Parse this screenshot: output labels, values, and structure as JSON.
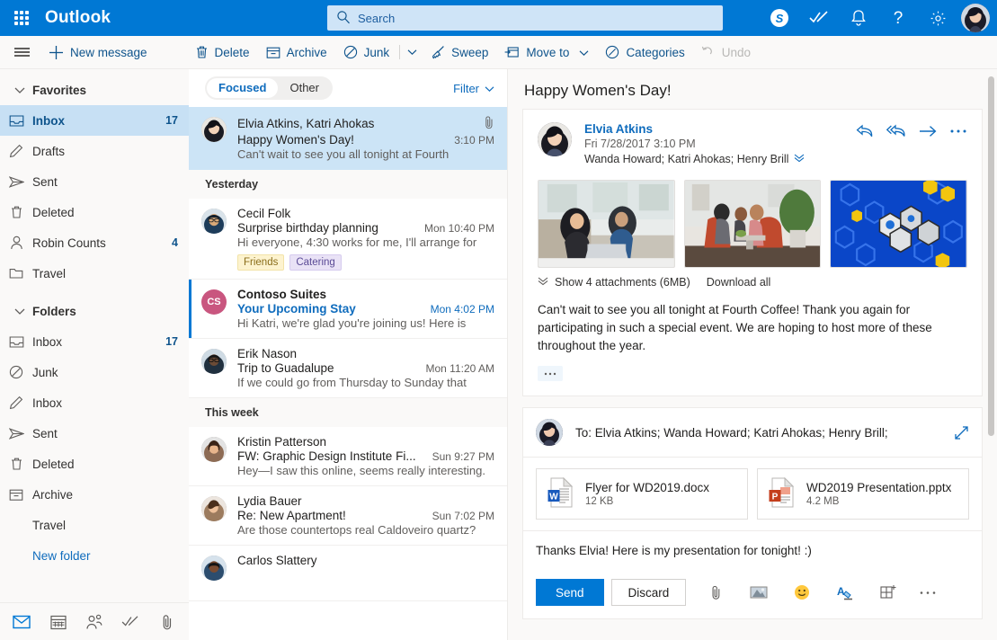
{
  "header": {
    "brand": "Outlook",
    "waffle_icon": "app-launcher-icon",
    "search": {
      "placeholder": "Search",
      "value": "",
      "icon": "search-icon"
    },
    "actions": [
      {
        "name": "skype-icon",
        "label": "S"
      },
      {
        "name": "to-do-icon",
        "label": ""
      },
      {
        "name": "notifications-bell-icon",
        "label": ""
      },
      {
        "name": "help-icon",
        "label": "?"
      },
      {
        "name": "settings-gear-icon",
        "label": ""
      }
    ],
    "avatar": "user-avatar"
  },
  "toolbar": {
    "menu_label": "",
    "new_message": "New message",
    "items": [
      {
        "label": "Delete",
        "icon": "trash-icon",
        "disabled": false
      },
      {
        "label": "Archive",
        "icon": "archive-icon",
        "disabled": false
      },
      {
        "label": "Junk",
        "icon": "block-icon",
        "disabled": false
      },
      {
        "label": "Sweep",
        "icon": "broom-icon",
        "disabled": false
      },
      {
        "label": "Move to",
        "icon": "move-to-icon",
        "disabled": false
      },
      {
        "label": "Categories",
        "icon": "category-tag-icon",
        "disabled": false
      },
      {
        "label": "Undo",
        "icon": "undo-icon",
        "disabled": true
      }
    ]
  },
  "sidebar": {
    "favorites": {
      "title": "Favorites",
      "items": [
        {
          "label": "Inbox",
          "count": "17",
          "icon": "inbox-icon",
          "selected": true
        },
        {
          "label": "Drafts",
          "count": "",
          "icon": "pencil-icon",
          "selected": false
        },
        {
          "label": "Sent",
          "count": "",
          "icon": "send-icon",
          "selected": false
        },
        {
          "label": "Deleted",
          "count": "",
          "icon": "trash-icon",
          "selected": false
        },
        {
          "label": "Robin Counts",
          "count": "4",
          "icon": "person-icon",
          "selected": false
        },
        {
          "label": "Travel",
          "count": "",
          "icon": "folder-icon",
          "selected": false
        }
      ]
    },
    "folders": {
      "title": "Folders",
      "items": [
        {
          "label": "Inbox",
          "count": "17",
          "icon": "inbox-icon"
        },
        {
          "label": "Junk",
          "count": "",
          "icon": "block-icon"
        },
        {
          "label": "Inbox",
          "count": "",
          "icon": "pencil-icon"
        },
        {
          "label": "Sent",
          "count": "",
          "icon": "send-icon"
        },
        {
          "label": "Deleted",
          "count": "",
          "icon": "trash-icon"
        },
        {
          "label": "Archive",
          "count": "",
          "icon": "archive-icon"
        },
        {
          "label": "Travel",
          "count": "",
          "icon": "none"
        }
      ],
      "new_folder": "New folder"
    },
    "rail": [
      {
        "name": "mail-icon",
        "active": true
      },
      {
        "name": "calendar-icon",
        "active": false
      },
      {
        "name": "people-icon",
        "active": false
      },
      {
        "name": "to-do-icon",
        "active": false
      },
      {
        "name": "files-attachment-icon",
        "active": false
      }
    ]
  },
  "list": {
    "pivots": [
      {
        "label": "Focused",
        "selected": true
      },
      {
        "label": "Other",
        "selected": false
      }
    ],
    "filter_label": "Filter",
    "groups": [
      {
        "header": "",
        "messages": [
          {
            "sender": "Elvia Atkins, Katri Ahokas",
            "subject": "Happy Women's Day!",
            "preview": "Can't wait to see you all tonight at Fourth",
            "time": "3:10 PM",
            "selected": true,
            "unread": false,
            "attachment": true,
            "avatar_type": "photo",
            "avatar_color": "#4a4a5c",
            "initials": "",
            "tags": []
          }
        ]
      },
      {
        "header": "Yesterday",
        "messages": [
          {
            "sender": "Cecil Folk",
            "subject": "Surprise birthday planning",
            "preview": "Hi everyone, 4:30 works for me, I'll arrange for",
            "time": "Mon 10:40 PM",
            "selected": false,
            "unread": false,
            "attachment": false,
            "avatar_type": "photo",
            "avatar_color": "#2c3e50",
            "initials": "",
            "tags": [
              {
                "label": "Friends",
                "style": "friends"
              },
              {
                "label": "Catering",
                "style": "catering"
              }
            ]
          },
          {
            "sender": "Contoso Suites",
            "subject": "Your Upcoming Stay",
            "preview": "Hi Katri, we're glad you're joining us! Here is",
            "time": "Mon 4:02 PM",
            "selected": false,
            "unread": true,
            "attachment": false,
            "avatar_type": "initials",
            "avatar_color": "#c9567f",
            "initials": "CS",
            "tags": []
          },
          {
            "sender": "Erik Nason",
            "subject": "Trip to Guadalupe",
            "preview": "If we could go from Thursday to Sunday that",
            "time": "Mon 11:20 AM",
            "selected": false,
            "unread": false,
            "attachment": false,
            "avatar_type": "photo",
            "avatar_color": "#3a3f4b",
            "initials": "",
            "tags": []
          }
        ]
      },
      {
        "header": "This week",
        "messages": [
          {
            "sender": "Kristin Patterson",
            "subject": "FW: Graphic Design Institute Fi...",
            "preview": "Hey—I saw this online, seems really interesting.",
            "time": "Sun 9:27 PM",
            "selected": false,
            "unread": false,
            "attachment": false,
            "avatar_type": "photo",
            "avatar_color": "#6b4a3a",
            "initials": "",
            "tags": []
          },
          {
            "sender": "Lydia Bauer",
            "subject": "Re: New Apartment!",
            "preview": "Are those countertops real Caldoveiro quartz?",
            "time": "Sun 7:02 PM",
            "selected": false,
            "unread": false,
            "attachment": false,
            "avatar_type": "photo",
            "avatar_color": "#7a5c46",
            "initials": "",
            "tags": []
          },
          {
            "sender": "Carlos Slattery",
            "subject": "",
            "preview": "",
            "time": "",
            "selected": false,
            "unread": false,
            "attachment": false,
            "avatar_type": "photo",
            "avatar_color": "#2f4a66",
            "initials": "",
            "tags": []
          }
        ]
      }
    ]
  },
  "reading": {
    "title": "Happy Women's Day!",
    "message": {
      "from": "Elvia Atkins",
      "date": "Fri 7/28/2017 3:10 PM",
      "recipients": "Wanda Howard; Katri Ahokas; Henry Brill",
      "actions": [
        {
          "name": "reply-icon"
        },
        {
          "name": "reply-all-icon"
        },
        {
          "name": "forward-icon"
        },
        {
          "name": "more-actions-icon"
        }
      ],
      "attachments_summary": "Show 4 attachments (6MB)",
      "download_all": "Download all",
      "body": "Can't wait to see you all tonight at Fourth Coffee! Thank you again for participating in such a special event. We are hoping to host more of these throughout the year.",
      "more_ellipsis": "· · ·",
      "thumbnails": [
        {
          "name": "thumbnail-two-women-laptop"
        },
        {
          "name": "thumbnail-office-meeting"
        },
        {
          "name": "thumbnail-blue-molecules"
        }
      ]
    },
    "reply": {
      "to_line": "To: Elvia Atkins; Wanda Howard; Katri Ahokas; Henry Brill;",
      "expand_icon": "expand-icon",
      "attachments": [
        {
          "filename": "Flyer for WD2019.docx",
          "size": "12 KB",
          "type": "word",
          "letter": "W",
          "color": "#185abd"
        },
        {
          "filename": "WD2019 Presentation.pptx",
          "size": "4.2 MB",
          "type": "powerpoint",
          "letter": "P",
          "color": "#c43e1c"
        }
      ],
      "body": "Thanks Elvia! Here is my presentation for tonight! :)",
      "send_label": "Send",
      "discard_label": "Discard",
      "tools": [
        {
          "name": "attach-file-icon"
        },
        {
          "name": "insert-picture-icon"
        },
        {
          "name": "emoji-icon"
        },
        {
          "name": "text-formatting-icon"
        },
        {
          "name": "insert-table-icon"
        },
        {
          "name": "more-options-icon"
        }
      ]
    }
  },
  "colors": {
    "brand_blue": "#0078d4",
    "link_blue": "#0f6cbd",
    "selected_row": "#cce4f6",
    "selected_folder": "#c7e0f4",
    "surface": "#faf9f8"
  }
}
